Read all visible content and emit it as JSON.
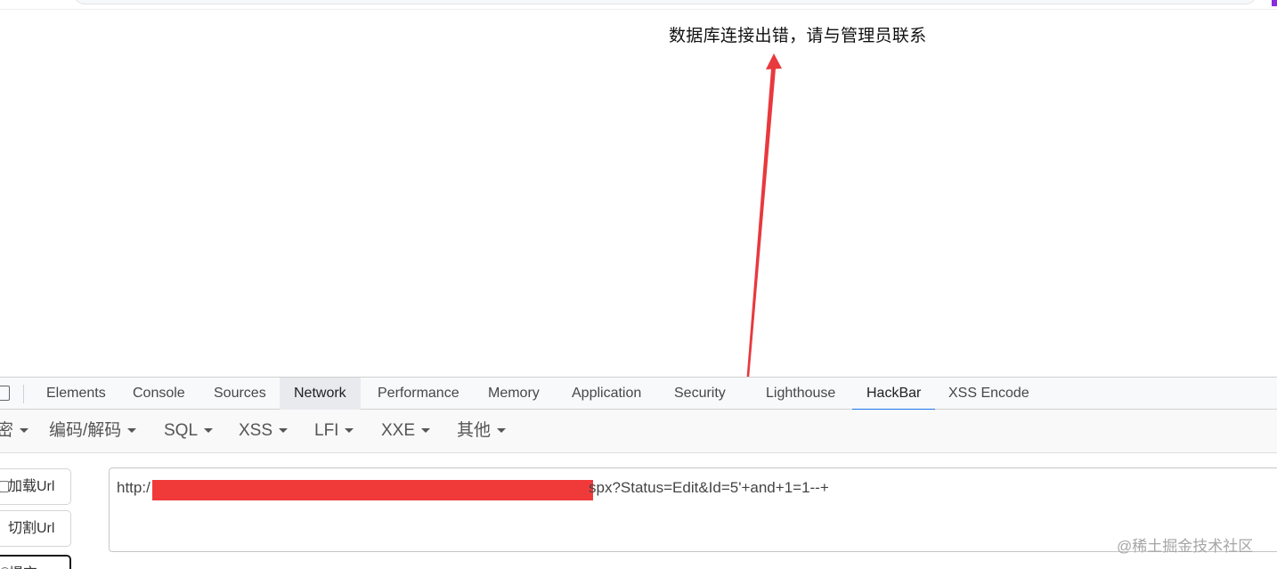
{
  "page": {
    "message": "数据库连接出错，请与管理员联系",
    "annotation_color": "#e8393e"
  },
  "devtools": {
    "tabs": [
      {
        "label": "Elements"
      },
      {
        "label": "Console"
      },
      {
        "label": "Sources"
      },
      {
        "label": "Network"
      },
      {
        "label": "Performance"
      },
      {
        "label": "Memory"
      },
      {
        "label": "Application"
      },
      {
        "label": "Security"
      },
      {
        "label": "Lighthouse"
      },
      {
        "label": "HackBar"
      },
      {
        "label": "XSS Encode"
      }
    ],
    "active_tab": "HackBar",
    "hovered_tab": "Network",
    "accent_color": "#1a73e8"
  },
  "hackbar": {
    "menus": [
      {
        "label": "密"
      },
      {
        "label": "编码/解码"
      },
      {
        "label": "SQL"
      },
      {
        "label": "XSS"
      },
      {
        "label": "LFI"
      },
      {
        "label": "XXE"
      },
      {
        "label": "其他"
      }
    ],
    "buttons": {
      "load_url": "加载Url",
      "split_url": "切割Url",
      "submit": "提交"
    },
    "url_prefix": "http:/",
    "url_suffix": "spx?Status=Edit&Id=5'+and+1=1--+",
    "redaction_color": "#f03a3a"
  },
  "watermark": "@稀土掘金技术社区"
}
